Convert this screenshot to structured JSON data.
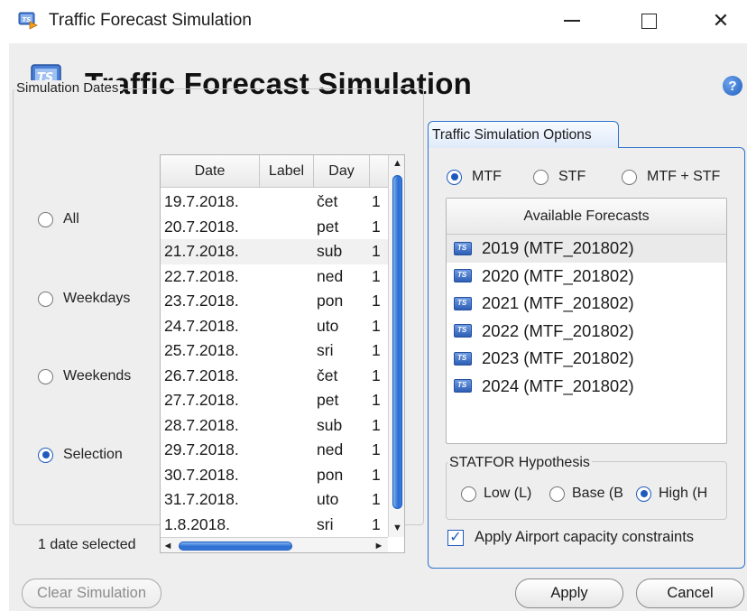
{
  "window": {
    "title": "Traffic Forecast Simulation",
    "controls": {
      "minimize": "minimize",
      "maximize": "maximize",
      "close": "✕"
    }
  },
  "header": {
    "title": "Traffic Forecast Simulation",
    "help_icon_text": "?"
  },
  "simulation_dates": {
    "legend": "Simulation Dates",
    "options": [
      {
        "label": "All",
        "selected": false
      },
      {
        "label": "Weekdays",
        "selected": false
      },
      {
        "label": "Weekends",
        "selected": false
      },
      {
        "label": "Selection",
        "selected": true
      }
    ],
    "table": {
      "columns": [
        "Date",
        "Label",
        "Day",
        ""
      ],
      "rows": [
        {
          "date": "19.7.2018.",
          "label": "",
          "day": "čet",
          "extra": "1"
        },
        {
          "date": "20.7.2018.",
          "label": "",
          "day": "pet",
          "extra": "1"
        },
        {
          "date": "21.7.2018.",
          "label": "",
          "day": "sub",
          "extra": "1"
        },
        {
          "date": "22.7.2018.",
          "label": "",
          "day": "ned",
          "extra": "1"
        },
        {
          "date": "23.7.2018.",
          "label": "",
          "day": "pon",
          "extra": "1"
        },
        {
          "date": "24.7.2018.",
          "label": "",
          "day": "uto",
          "extra": "1"
        },
        {
          "date": "25.7.2018.",
          "label": "",
          "day": "sri",
          "extra": "1"
        },
        {
          "date": "26.7.2018.",
          "label": "",
          "day": "čet",
          "extra": "1"
        },
        {
          "date": "27.7.2018.",
          "label": "",
          "day": "pet",
          "extra": "1"
        },
        {
          "date": "28.7.2018.",
          "label": "",
          "day": "sub",
          "extra": "1"
        },
        {
          "date": "29.7.2018.",
          "label": "",
          "day": "ned",
          "extra": "1"
        },
        {
          "date": "30.7.2018.",
          "label": "",
          "day": "pon",
          "extra": "1"
        },
        {
          "date": "31.7.2018.",
          "label": "",
          "day": "uto",
          "extra": "1"
        },
        {
          "date": "1.8.2018.",
          "label": "",
          "day": "sri",
          "extra": "1"
        }
      ],
      "scroll_up": "▲",
      "scroll_down": "▼",
      "scroll_left": "◄",
      "scroll_right": "►"
    },
    "status": "1 date selected"
  },
  "options_tab": {
    "label": "Traffic Simulation Options",
    "mode_options": [
      {
        "label": "MTF",
        "selected": true
      },
      {
        "label": "STF",
        "selected": false
      },
      {
        "label": "MTF + STF",
        "selected": false
      }
    ],
    "forecasts": {
      "header": "Available Forecasts",
      "items": [
        "2019 (MTF_201802)",
        "2020 (MTF_201802)",
        "2021 (MTF_201802)",
        "2022 (MTF_201802)",
        "2023 (MTF_201802)",
        "2024 (MTF_201802)"
      ]
    },
    "statfor": {
      "legend": "STATFOR Hypothesis",
      "options": [
        {
          "label": "Low (L)",
          "selected": false
        },
        {
          "label": "Base (B",
          "selected": false
        },
        {
          "label": "High (H",
          "selected": true
        }
      ]
    },
    "airport_constraints": {
      "label": "Apply Airport capacity constraints",
      "checked": true,
      "check_mark": "✓"
    }
  },
  "buttons": {
    "clear": "Clear Simulation",
    "apply": "Apply",
    "cancel": "Cancel"
  },
  "colors": {
    "accent": "#2f73cc",
    "radio_selected": "#1f5bbd",
    "dialog_bg": "#eeeeee"
  },
  "icons": [
    "ts-app-icon",
    "help-icon",
    "forecast-icon"
  ]
}
